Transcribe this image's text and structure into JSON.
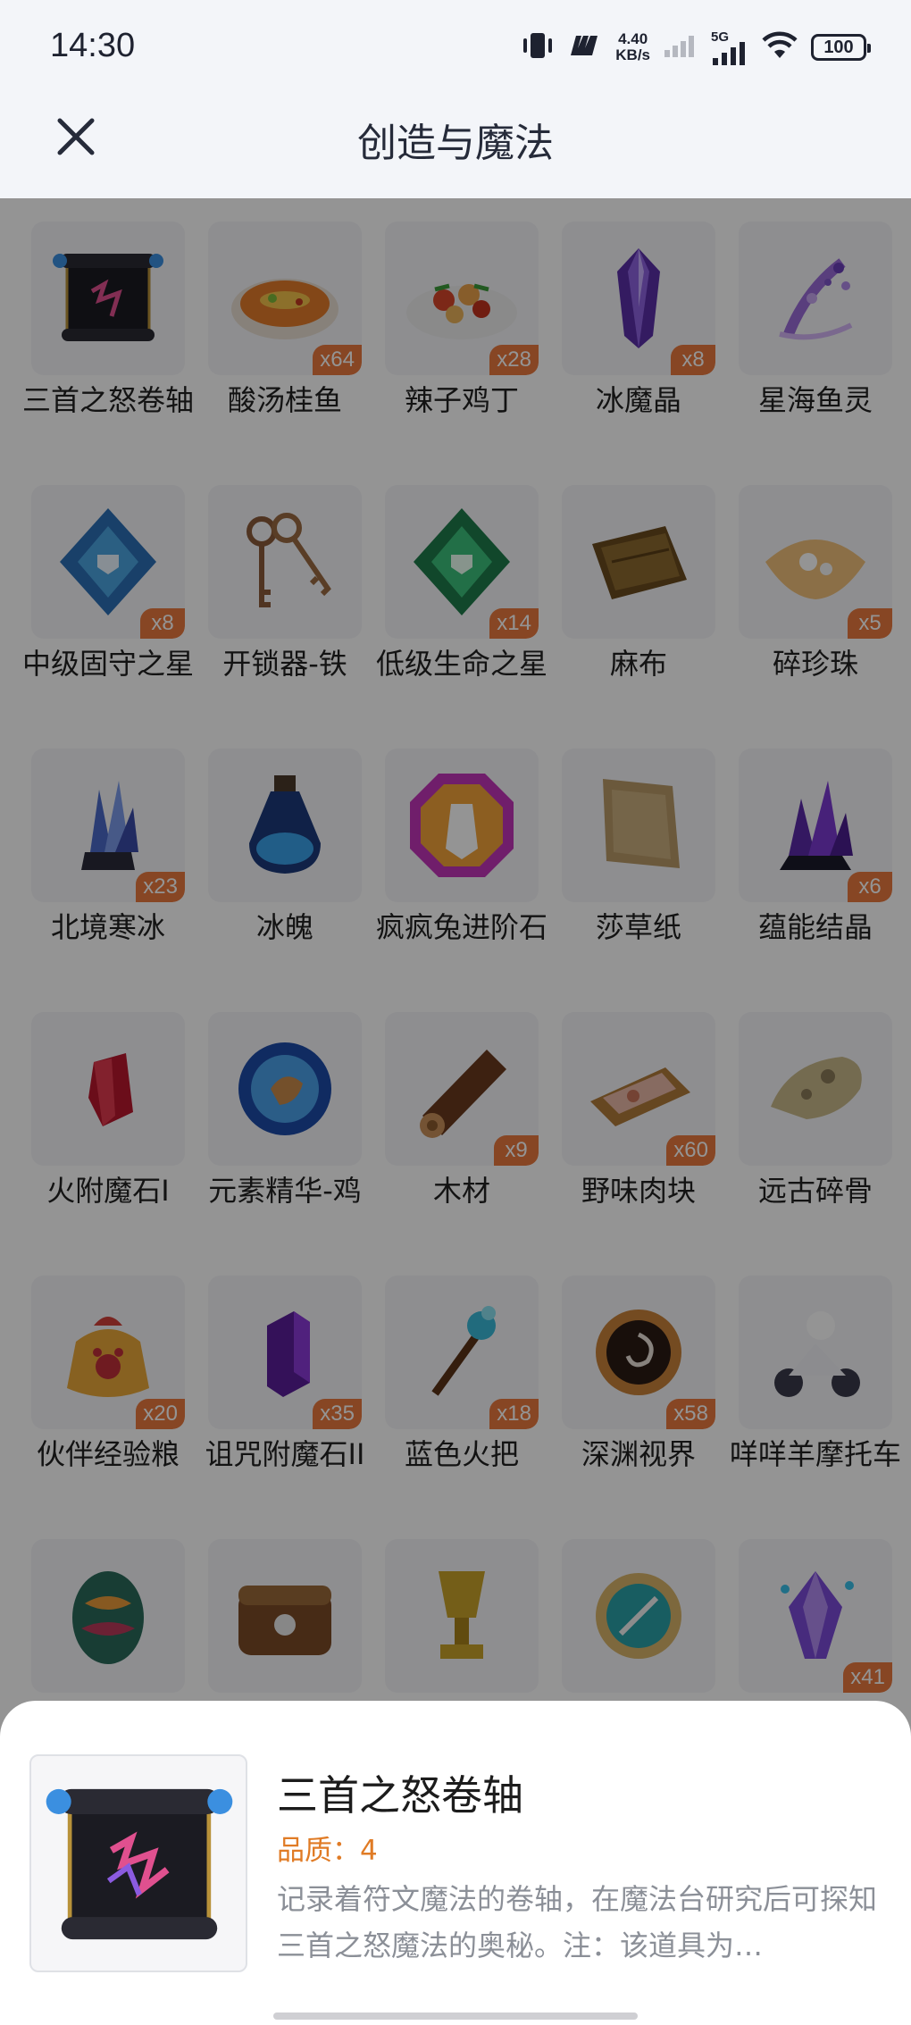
{
  "status_bar": {
    "time": "14:30",
    "net_speed_value": "4.40",
    "net_speed_unit": "KB/s",
    "network_type": "5G",
    "battery": "100"
  },
  "header": {
    "title": "创造与魔法"
  },
  "items": [
    {
      "name": "三首之怒卷轴",
      "count": "",
      "icon": "scroll-icon"
    },
    {
      "name": "酸汤桂鱼",
      "count": "x64",
      "icon": "fish-soup-icon"
    },
    {
      "name": "辣子鸡丁",
      "count": "x28",
      "icon": "spicy-chicken-icon"
    },
    {
      "name": "冰魔晶",
      "count": "x8",
      "icon": "ice-crystal-icon"
    },
    {
      "name": "星海鱼灵",
      "count": "",
      "icon": "star-sea-fish-icon"
    },
    {
      "name": "中级固守之星",
      "count": "x8",
      "icon": "blue-star-gem-icon"
    },
    {
      "name": "开锁器-铁",
      "count": "",
      "icon": "keys-icon"
    },
    {
      "name": "低级生命之星",
      "count": "x14",
      "icon": "green-star-gem-icon"
    },
    {
      "name": "麻布",
      "count": "",
      "icon": "linen-cloth-icon"
    },
    {
      "name": "碎珍珠",
      "count": "x5",
      "icon": "broken-pearl-icon"
    },
    {
      "name": "北境寒冰",
      "count": "x23",
      "icon": "north-ice-icon"
    },
    {
      "name": "冰魄",
      "count": "",
      "icon": "ice-potion-icon"
    },
    {
      "name": "疯疯兔进阶石",
      "count": "",
      "icon": "rabbit-stone-icon"
    },
    {
      "name": "莎草纸",
      "count": "",
      "icon": "papyrus-icon"
    },
    {
      "name": "蕴能结晶",
      "count": "x6",
      "icon": "energy-crystal-icon"
    },
    {
      "name": "火附魔石I",
      "count": "",
      "icon": "fire-enchant-stone-icon"
    },
    {
      "name": "元素精华-鸡",
      "count": "",
      "icon": "element-essence-icon"
    },
    {
      "name": "木材",
      "count": "x9",
      "icon": "wood-log-icon"
    },
    {
      "name": "野味肉块",
      "count": "x60",
      "icon": "game-meat-icon"
    },
    {
      "name": "远古碎骨",
      "count": "",
      "icon": "ancient-bone-icon"
    },
    {
      "name": "伙伴经验粮",
      "count": "x20",
      "icon": "pet-food-bag-icon"
    },
    {
      "name": "诅咒附魔石II",
      "count": "x35",
      "icon": "curse-enchant-stone-icon"
    },
    {
      "name": "蓝色火把",
      "count": "x18",
      "icon": "blue-torch-icon"
    },
    {
      "name": "深渊视界",
      "count": "x58",
      "icon": "abyss-vision-icon"
    },
    {
      "name": "咩咩羊摩托车",
      "count": "",
      "icon": "sheep-motorcycle-icon"
    },
    {
      "name": "",
      "count": "",
      "icon": "dragon-egg-icon"
    },
    {
      "name": "",
      "count": "",
      "icon": "leather-bag-icon"
    },
    {
      "name": "",
      "count": "",
      "icon": "golden-trophy-icon"
    },
    {
      "name": "",
      "count": "",
      "icon": "compass-icon"
    },
    {
      "name": "",
      "count": "x41",
      "icon": "purple-crystal-icon"
    }
  ],
  "detail": {
    "name": "三首之怒卷轴",
    "quality": "品质：4",
    "description": "记录着符文魔法的卷轴，在魔法台研究后可探知三首之怒魔法的奥秘。注：该道具为…"
  },
  "colors": {
    "badge": "#e8793e",
    "quality": "#e07b25",
    "title": "#262b3a"
  }
}
